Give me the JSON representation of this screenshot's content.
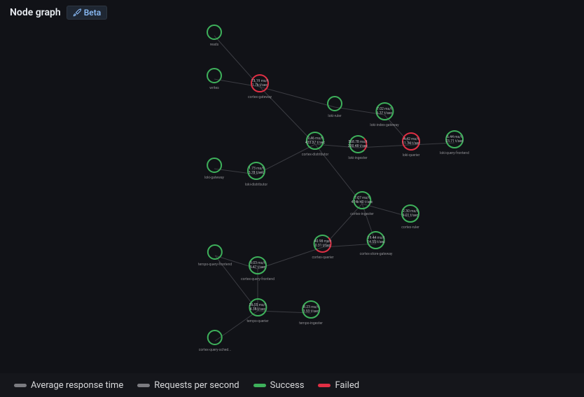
{
  "header": {
    "title": "Node graph",
    "beta": "Beta"
  },
  "legend": {
    "avg": "Average response time",
    "rps": "Requests per second",
    "success": "Success",
    "failed": "Failed"
  },
  "nodes": {
    "reads": {
      "label": "reads",
      "l1": "",
      "l2": ""
    },
    "writes": {
      "label": "writes",
      "l1": "",
      "l2": ""
    },
    "cortex_gateway": {
      "label": "cortex-gateway",
      "l1": "13.19 ms/t",
      "l2": "1.7k t/sec"
    },
    "loki_ruler": {
      "label": "loki-ruler",
      "l1": "",
      "l2": ""
    },
    "loki_index_gateway": {
      "label": "loki-index-gateway",
      "l1": "7.02 ms/t",
      "l2": "6.37 t/sec"
    },
    "cortex_distributor": {
      "label": "cortex-distributor",
      "l1": "2.46 ms/t",
      "l2": "433.27 t/sec"
    },
    "loki_ingester": {
      "label": "loki-ingester",
      "l1": "568.78 ms/t",
      "l2": "200.48 t/sec"
    },
    "loki_querier": {
      "label": "loki-querier",
      "l1": "4.42 ms/t",
      "l2": "11.34 t/sec"
    },
    "loki_query_frontend": {
      "label": "loki-query-frontend",
      "l1": "6.44 ms/t",
      "l2": "23.71 t/sec"
    },
    "loki_gateway": {
      "label": "loki-gateway",
      "l1": "",
      "l2": ""
    },
    "loki_distributor": {
      "label": "loki-distributor",
      "l1": "1.73 ms/t",
      "l2": "3.78 t/sec"
    },
    "cortex_ingester": {
      "label": "cortex-ingester",
      "l1": "1.07 ms/t",
      "l2": "474k-40 t/sec"
    },
    "cortex_ruler": {
      "label": "cortex-ruler",
      "l1": "2.30 ms/t",
      "l2": "9.01 t/sec"
    },
    "cortex_querier": {
      "label": "cortex-querier",
      "l1": "40.98 ms/t",
      "l2": "0.31 t/sec"
    },
    "cortex_store_gateway": {
      "label": "cortex-store-gateway",
      "l1": "19.44 ms/t",
      "l2": "14.55 t/sec"
    },
    "tempo_query_frontend": {
      "label": "tempo-query-frontend",
      "l1": "",
      "l2": ""
    },
    "cortex_query_frontend": {
      "label": "cortex-query-frontend",
      "l1": "9.03 ms/t",
      "l2": "5.47 t/sec"
    },
    "tempo_querier": {
      "label": "tempo-querier",
      "l1": "36.55 ms/t",
      "l2": "4.38 t/sec"
    },
    "tempo_ingester": {
      "label": "tempo-ingester",
      "l1": "8.23 ms/t",
      "l2": "3.93 t/sec"
    },
    "cortex_query_sched": {
      "label": "cortex-query-sched...",
      "l1": "",
      "l2": ""
    }
  }
}
